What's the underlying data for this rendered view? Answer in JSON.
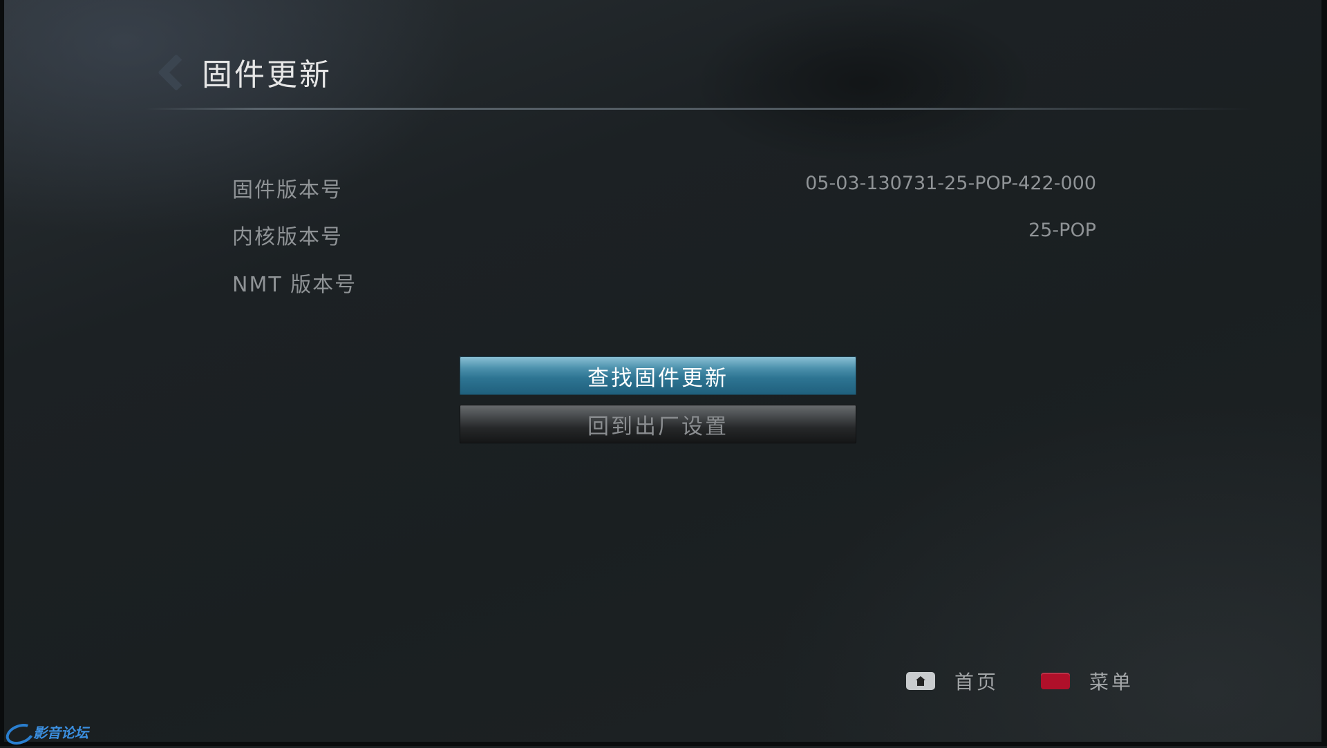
{
  "header": {
    "title": "固件更新"
  },
  "info": [
    {
      "label": "固件版本号",
      "value": "05-03-130731-25-POP-422-000"
    },
    {
      "label": "内核版本号",
      "value": "25-POP"
    },
    {
      "label": "NMT 版本号",
      "value": ""
    }
  ],
  "actions": {
    "check_update": "查找固件更新",
    "factory_reset": "回到出厂设置"
  },
  "footer": {
    "home_label": "首页",
    "menu_label": "菜单",
    "home_icon": "home-icon",
    "menu_key_color": "#b0102a"
  },
  "watermark": {
    "text": "影音论坛"
  },
  "colors": {
    "accent": "#2e7593",
    "background": "#1a1f21"
  }
}
